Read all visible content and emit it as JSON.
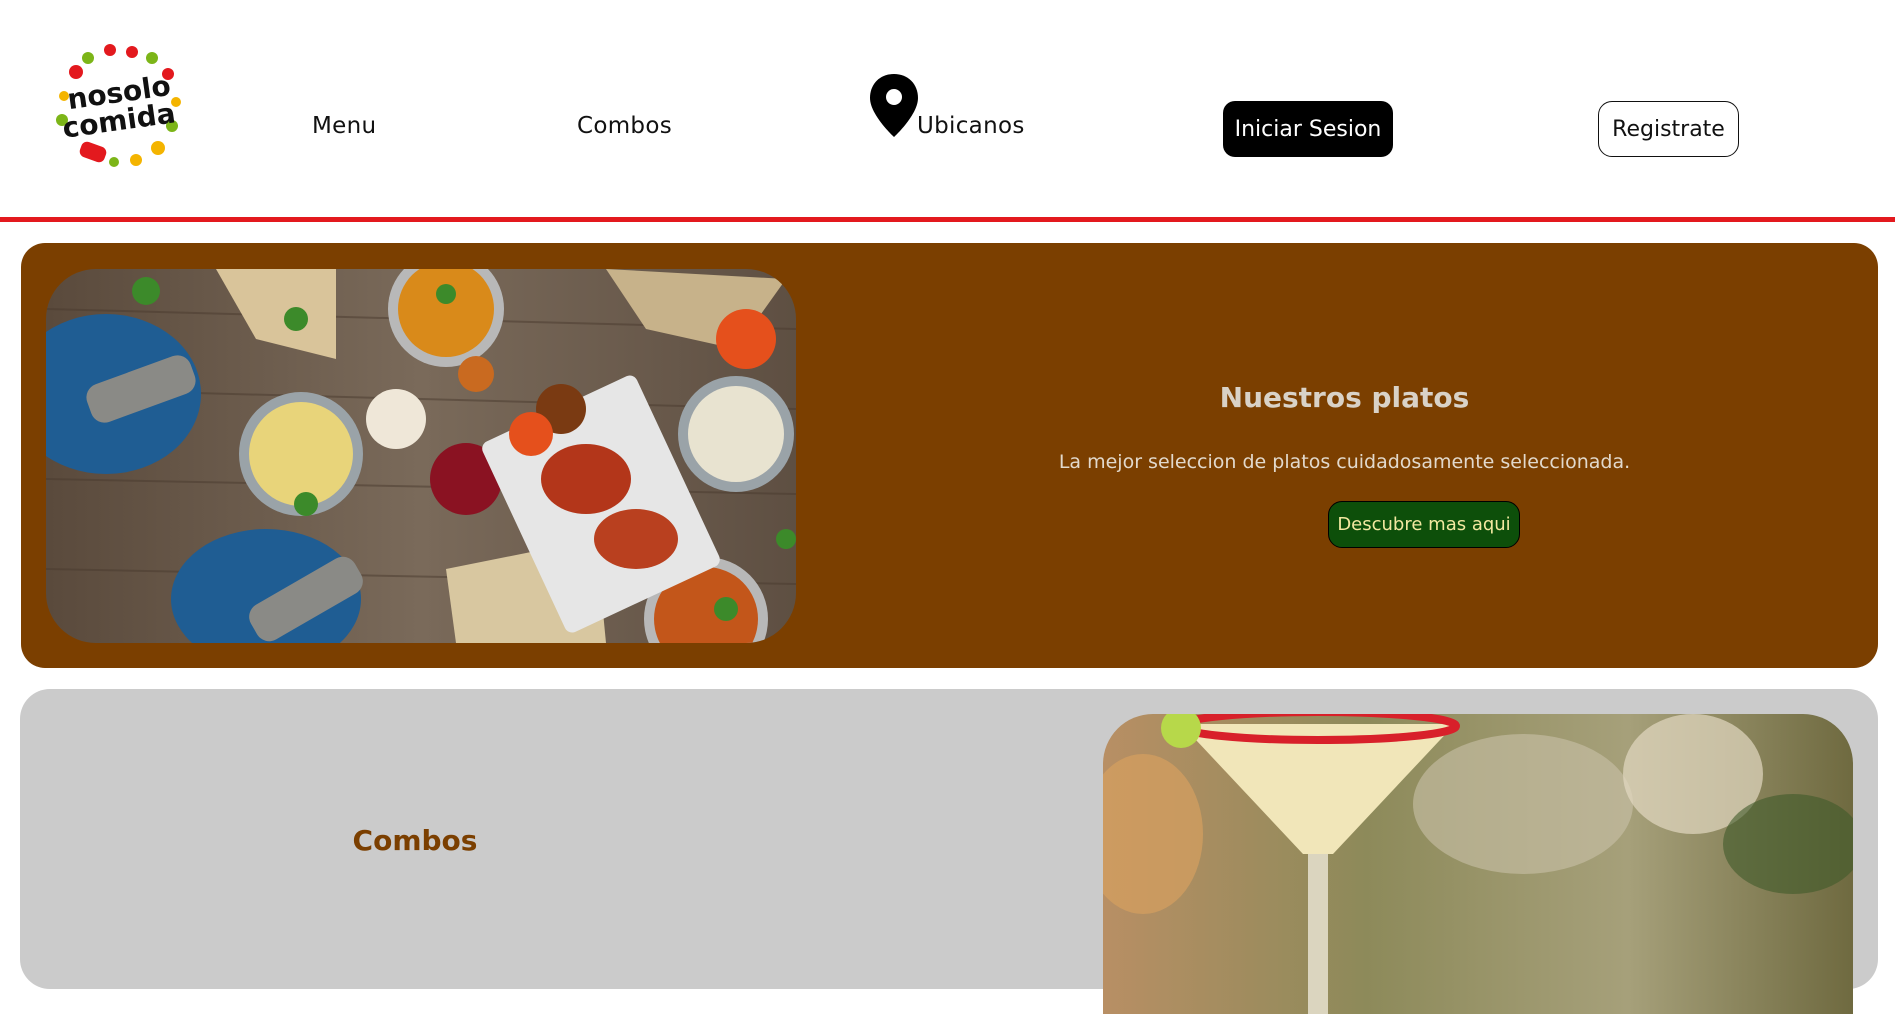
{
  "brand": {
    "logo_text_line1": "nosolo",
    "logo_text_line2": "comida"
  },
  "nav": {
    "menu_label": "Menu",
    "combos_label": "Combos",
    "ubicanos_label": "Ubicanos",
    "login_label": "Iniciar Sesion",
    "register_label": "Registrate"
  },
  "featured_platos": {
    "title": "Nuestros platos",
    "description": "La mejor seleccion de platos cuidadosamente seleccionada.",
    "cta_label": "Descubre mas aqui"
  },
  "featured_combos": {
    "title": "Combos"
  },
  "colors": {
    "accent_red": "#e3191e",
    "platos_bg": "#7b3f00",
    "combos_bg": "#cbcbcb",
    "cta_green": "#0d4f0a"
  },
  "icons": [
    "logo-emblem",
    "location-pin-icon"
  ]
}
